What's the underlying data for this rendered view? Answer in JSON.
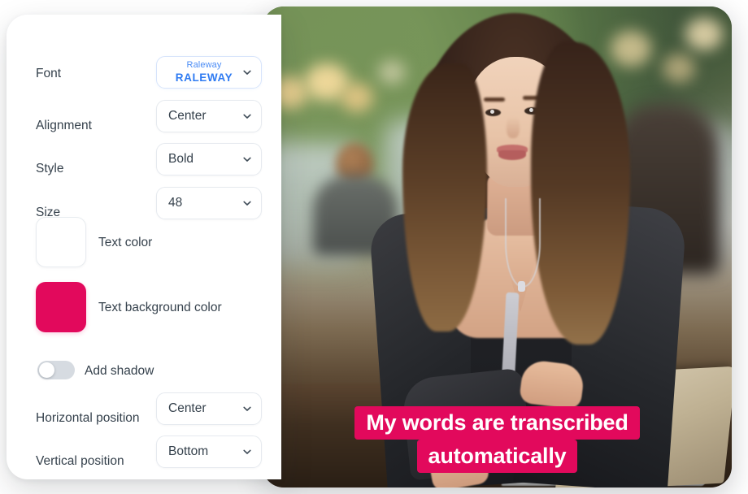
{
  "panel": {
    "rows": [
      {
        "label": "Font",
        "value": "Raleway",
        "preview": "RALEWAY",
        "type": "font-select"
      },
      {
        "label": "Alignment",
        "value": "Center",
        "type": "select"
      },
      {
        "label": "Style",
        "value": "Bold",
        "type": "select"
      },
      {
        "label": "Size",
        "value": "48",
        "type": "select"
      }
    ],
    "colors": [
      {
        "label": "Text color",
        "hex": "#FFFFFF"
      },
      {
        "label": "Text background color",
        "hex": "#E2095C"
      }
    ],
    "shadow": {
      "label": "Add shadow",
      "state": "off"
    },
    "positions": [
      {
        "label": "Horizontal position",
        "value": "Center"
      },
      {
        "label": "Vertical position",
        "value": "Bottom"
      }
    ],
    "icons": {
      "chevron": "chevron-down-icon"
    }
  },
  "preview": {
    "caption_lines": [
      "My words are transcribed",
      "automatically"
    ],
    "caption_bg": "#E2095C",
    "caption_color": "#FFFFFF"
  }
}
